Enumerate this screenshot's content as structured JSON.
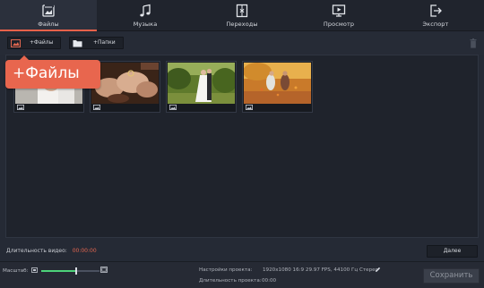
{
  "nav": {
    "tabs": [
      {
        "label": "Файлы",
        "icon": "files-icon",
        "active": true
      },
      {
        "label": "Музыка",
        "icon": "music-icon",
        "active": false
      },
      {
        "label": "Переходы",
        "icon": "transitions-icon",
        "active": false
      },
      {
        "label": "Просмотр",
        "icon": "preview-icon",
        "active": false
      },
      {
        "label": "Экспорт",
        "icon": "export-icon",
        "active": false
      }
    ]
  },
  "toolbar": {
    "add_files_label": "+Файлы",
    "add_folders_label": "+Папки"
  },
  "callout": {
    "text": "+Файлы"
  },
  "media": {
    "thumbnails": [
      {
        "subject": "bride-portrait",
        "icon": "image-icon"
      },
      {
        "subject": "hands-with-rings",
        "icon": "image-icon"
      },
      {
        "subject": "wedding-couple-park",
        "icon": "image-icon"
      },
      {
        "subject": "couple-autumn-leaves",
        "icon": "image-icon"
      }
    ]
  },
  "footer": {
    "duration_label": "Длительность видео:",
    "duration_value": "00:00:00",
    "next_label": "Далее"
  },
  "status": {
    "zoom_label": "Масштаб:",
    "zoom_level": 0.6,
    "settings_label": "Настройки проекта:",
    "settings_value": "1920x1080 16:9 29.97 FPS, 44100 Гц Стерео",
    "proj_duration_label": "Длительность проекта:",
    "proj_duration_value": "00:00",
    "save_label": "Сохранить"
  },
  "colors": {
    "accent": "#e8614a",
    "callout": "#e8664e",
    "zoom_fill": "#4dd37a",
    "duration_value": "#e26650"
  }
}
